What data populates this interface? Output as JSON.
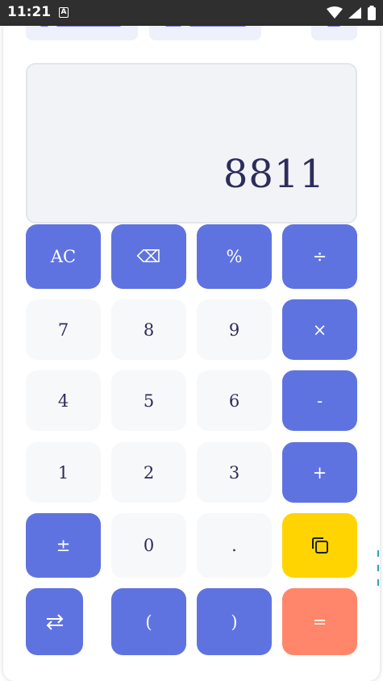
{
  "status_bar": {
    "time": "11:21",
    "notification_glyph": "A"
  },
  "display": {
    "value": "8811"
  },
  "keys": {
    "row1": [
      "AC",
      "⌫",
      "%",
      "÷"
    ],
    "row2": [
      "7",
      "8",
      "9",
      "×"
    ],
    "row3": [
      "4",
      "5",
      "6",
      "-"
    ],
    "row4": [
      "1",
      "2",
      "3",
      "+"
    ],
    "row5": [
      "±",
      "0",
      "."
    ],
    "row6": [
      "(",
      ")",
      "="
    ]
  },
  "icons": {
    "copy": "copy-icon",
    "swap": "swap-arrows-icon",
    "wifi": "wifi-icon",
    "signal": "signal-icon",
    "battery": "battery-icon"
  },
  "colors": {
    "operator": "#5f73e0",
    "number": "#f7f8f9",
    "copy": "#ffd400",
    "equals": "#ff866a",
    "display_bg": "#f2f3f7",
    "text": "#2c2d5a"
  }
}
